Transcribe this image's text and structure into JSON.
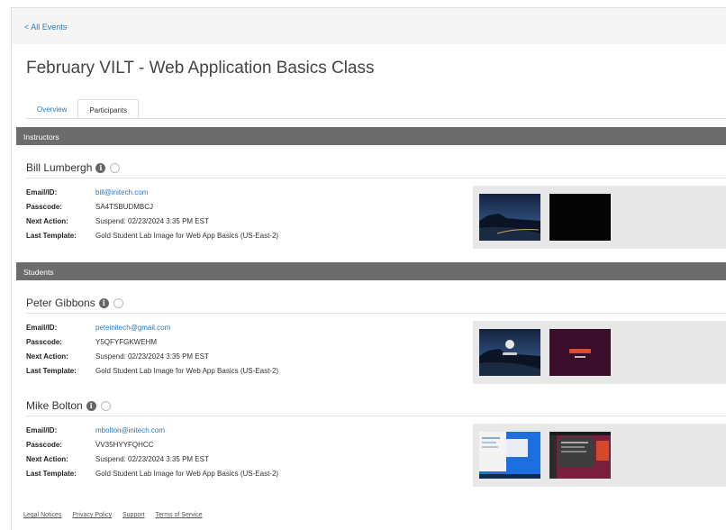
{
  "nav": {
    "back_label": "< All Events"
  },
  "page": {
    "title": "February VILT - Web Application Basics Class"
  },
  "tabs": [
    {
      "label": "Overview",
      "active": false
    },
    {
      "label": "Participants",
      "active": true
    }
  ],
  "instructors": {
    "header": "Instructors",
    "people": [
      {
        "name": "Bill Lumbergh",
        "email_label": "Email/ID:",
        "email": "bill@initech.com",
        "passcode_label": "Passcode:",
        "passcode": "SA4TSBUDMBCJ",
        "next_action_label": "Next Action:",
        "next_action": "Suspend: 02/23/2024 3:35 PM EST",
        "template_label": "Last Template:",
        "template": "Gold Student Lab Image for Web App Basics (US-East-2)"
      }
    ]
  },
  "students": {
    "header": "Students",
    "people": [
      {
        "name": "Peter Gibbons",
        "email_label": "Email/ID:",
        "email": "peteinitech@gmail.com",
        "passcode_label": "Passcode:",
        "passcode": "Y5QFYFGKWEHM",
        "next_action_label": "Next Action:",
        "next_action": "Suspend: 02/23/2024 3:35 PM EST",
        "template_label": "Last Template:",
        "template": "Gold Student Lab Image for Web App Basics (US-East-2)"
      },
      {
        "name": "Mike Bolton",
        "email_label": "Email/ID:",
        "email": "mbolton@initech.com",
        "passcode_label": "Passcode:",
        "passcode": "VV35HYYFQHCC",
        "next_action_label": "Next Action:",
        "next_action": "Suspend: 02/23/2024 3:35 PM EST",
        "template_label": "Last Template:",
        "template": "Gold Student Lab Image for Web App Basics (US-East-2)"
      }
    ]
  },
  "footer": {
    "links": [
      "Legal Notices",
      "Privacy Policy",
      "Support",
      "Terms of Service"
    ]
  },
  "colors": {
    "link": "#2a7ab8",
    "section_bar": "#6c6c6c",
    "thumb_panel": "#e8e8e8"
  }
}
